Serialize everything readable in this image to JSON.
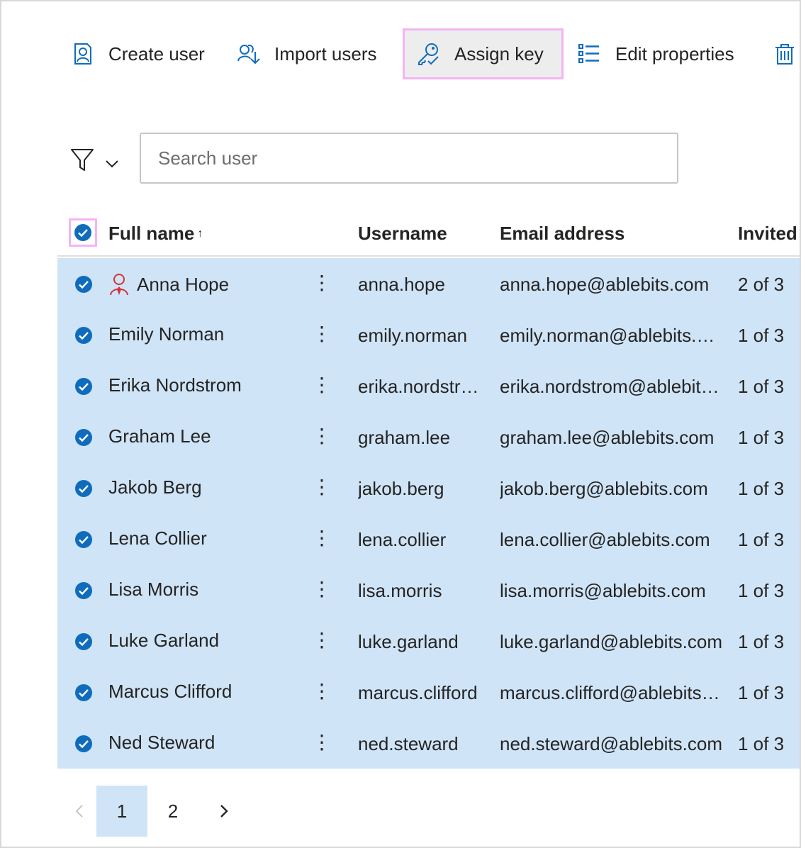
{
  "toolbar": {
    "create_user": "Create user",
    "import_users": "Import users",
    "assign_key": "Assign key",
    "edit_properties": "Edit properties"
  },
  "search": {
    "placeholder": "Search user"
  },
  "table": {
    "headers": {
      "full_name": "Full name",
      "sort_indicator": "↑",
      "username": "Username",
      "email": "Email address",
      "invited": "Invited"
    },
    "rows": [
      {
        "name": "Anna Hope",
        "username": "anna.hope",
        "email": "anna.hope@ablebits.com",
        "invited": "2 of 3",
        "admin": true
      },
      {
        "name": "Emily Norman",
        "username": "emily.norman",
        "email": "emily.norman@ablebits.com",
        "invited": "1 of 3"
      },
      {
        "name": "Erika Nordstrom",
        "username": "erika.nordstrom",
        "email": "erika.nordstrom@ablebits.com",
        "invited": "1 of 3"
      },
      {
        "name": "Graham Lee",
        "username": "graham.lee",
        "email": "graham.lee@ablebits.com",
        "invited": "1 of 3"
      },
      {
        "name": "Jakob Berg",
        "username": "jakob.berg",
        "email": "jakob.berg@ablebits.com",
        "invited": "1 of 3"
      },
      {
        "name": "Lena Collier",
        "username": "lena.collier",
        "email": "lena.collier@ablebits.com",
        "invited": "1 of 3"
      },
      {
        "name": "Lisa Morris",
        "username": "lisa.morris",
        "email": "lisa.morris@ablebits.com",
        "invited": "1 of 3"
      },
      {
        "name": "Luke Garland",
        "username": "luke.garland",
        "email": "luke.garland@ablebits.com",
        "invited": "1 of 3"
      },
      {
        "name": "Marcus Clifford",
        "username": "marcus.clifford",
        "email": "marcus.clifford@ablebits.com",
        "invited": "1 of 3"
      },
      {
        "name": "Ned Steward",
        "username": "ned.steward",
        "email": "ned.steward@ablebits.com",
        "invited": "1 of 3"
      }
    ]
  },
  "pagination": {
    "pages": [
      "1",
      "2"
    ],
    "current": "1"
  },
  "colors": {
    "accent": "#0f6cbd",
    "selection": "#cfe4f7",
    "highlight": "#f3b5f2",
    "admin": "#d13438"
  },
  "icons": {
    "create": "person-add-icon",
    "import": "people-import-icon",
    "assign": "key-check-icon",
    "edit": "list-icon",
    "delete": "trash-icon",
    "filter": "funnel-icon",
    "check": "check-circle-icon",
    "admin": "admin-person-icon"
  }
}
